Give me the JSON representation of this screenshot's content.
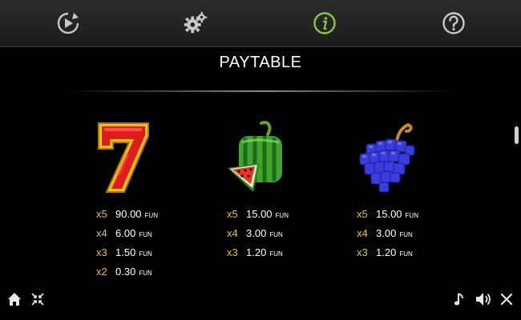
{
  "header": {
    "buttons": [
      {
        "name": "autoplay-icon"
      },
      {
        "name": "settings-icon"
      },
      {
        "name": "info-icon",
        "active": true,
        "color": "#8cc63f"
      },
      {
        "name": "help-icon"
      }
    ]
  },
  "title": "PAYTABLE",
  "symbols": [
    {
      "name": "seven",
      "icon": "seven-symbol-icon",
      "pays": [
        {
          "mult": "x5",
          "amount": "90.00",
          "currency": "FUN"
        },
        {
          "mult": "x4",
          "amount": "6.00",
          "currency": "FUN"
        },
        {
          "mult": "x3",
          "amount": "1.50",
          "currency": "FUN"
        },
        {
          "mult": "x2",
          "amount": "0.30",
          "currency": "FUN"
        }
      ]
    },
    {
      "name": "watermelon",
      "icon": "watermelon-symbol-icon",
      "pays": [
        {
          "mult": "x5",
          "amount": "15.00",
          "currency": "FUN"
        },
        {
          "mult": "x4",
          "amount": "3.00",
          "currency": "FUN"
        },
        {
          "mult": "x3",
          "amount": "1.20",
          "currency": "FUN"
        }
      ]
    },
    {
      "name": "grapes",
      "icon": "grapes-symbol-icon",
      "pays": [
        {
          "mult": "x5",
          "amount": "15.00",
          "currency": "FUN"
        },
        {
          "mult": "x4",
          "amount": "3.00",
          "currency": "FUN"
        },
        {
          "mult": "x3",
          "amount": "1.20",
          "currency": "FUN"
        }
      ]
    }
  ],
  "colors": {
    "multiplier": "#f2c21a",
    "active_tab": "#8cc63f",
    "background": "#000000"
  },
  "footer": {
    "left": [
      "home-icon",
      "collapse-icon"
    ],
    "right": [
      "music-icon",
      "sound-icon",
      "close-icon"
    ]
  }
}
